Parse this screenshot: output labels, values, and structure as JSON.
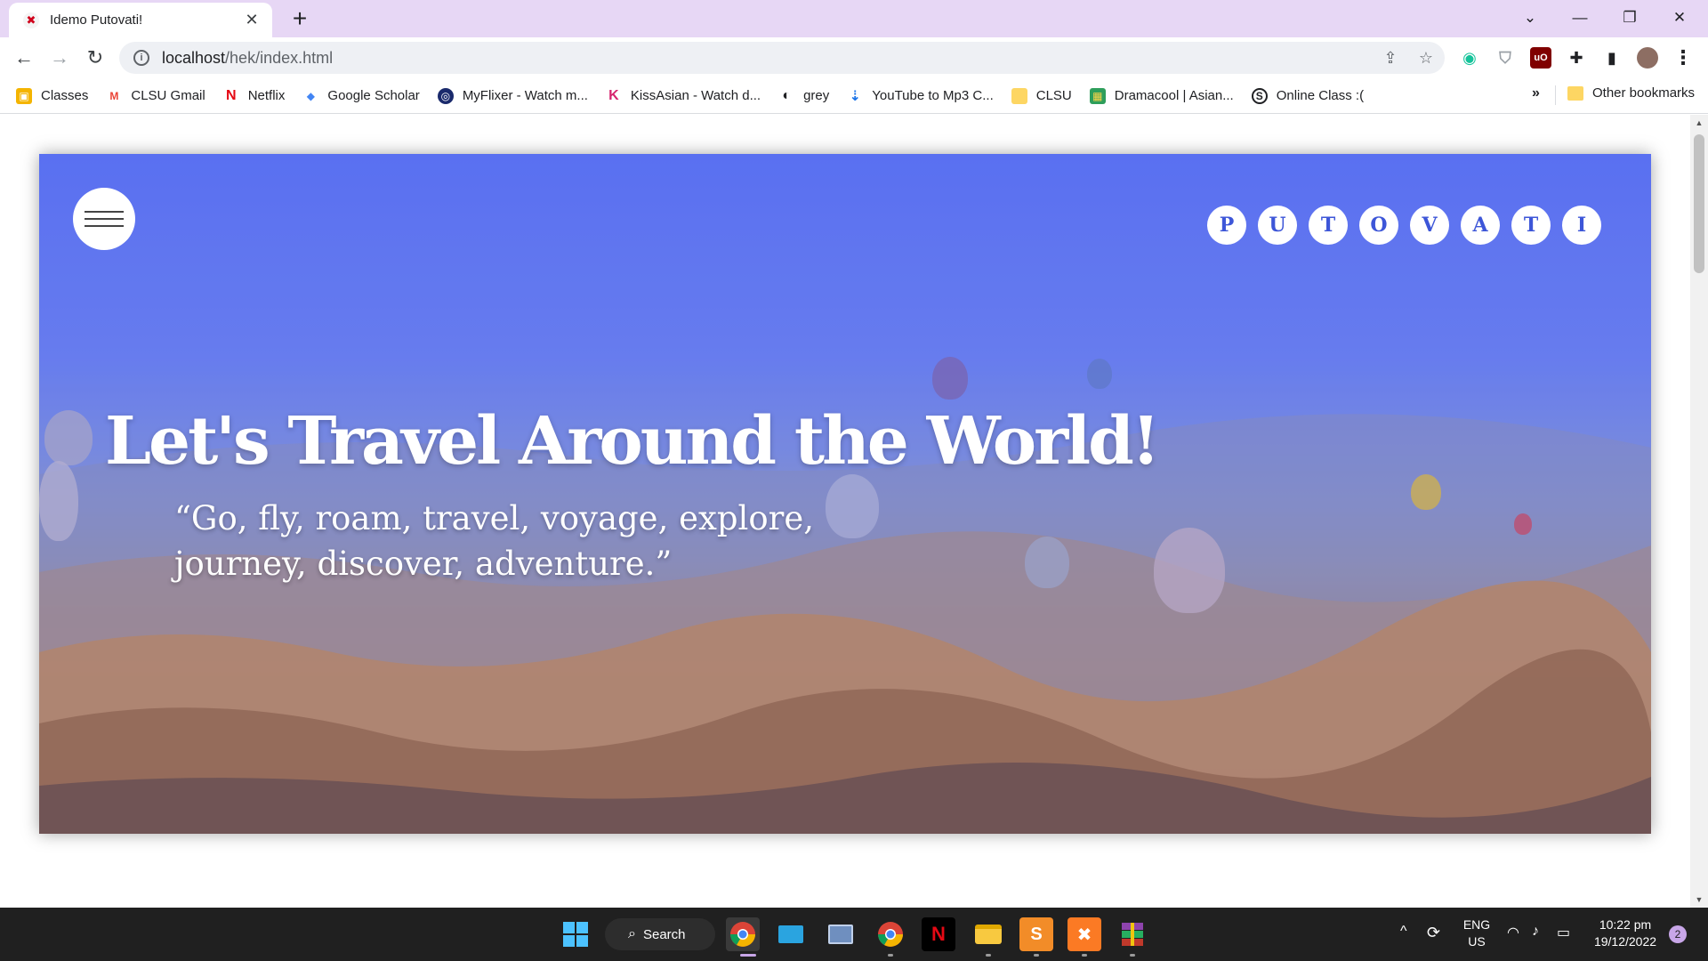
{
  "browser": {
    "tab_title": "Idemo Putovati!",
    "tab_close": "✕",
    "new_tab": "+",
    "window_controls": {
      "dropdown": "⌄",
      "minimize": "—",
      "restore": "❐",
      "close": "✕"
    },
    "nav": {
      "back": "←",
      "forward": "→",
      "reload": "↻"
    },
    "url_host": "localhost",
    "url_path": "/hek/index.html",
    "omnibox_icons": {
      "info": "i",
      "share": "⇪",
      "star": "☆"
    },
    "menu_icon": "⋮"
  },
  "bookmarks": [
    {
      "label": "Classes",
      "icon": "classroom-icon",
      "color": "#f4b400",
      "glyph": "▣"
    },
    {
      "label": "CLSU Gmail",
      "icon": "gmail-icon",
      "color": "#ea4335",
      "glyph": "M"
    },
    {
      "label": "Netflix",
      "icon": "netflix-icon",
      "color": "#e50914",
      "glyph": "N"
    },
    {
      "label": "Google Scholar",
      "icon": "scholar-icon",
      "color": "#4285f4",
      "glyph": "◆"
    },
    {
      "label": "MyFlixer - Watch m...",
      "icon": "myflixer-icon",
      "color": "#1a2a6c",
      "glyph": "◎"
    },
    {
      "label": "KissAsian - Watch d...",
      "icon": "kissasian-icon",
      "color": "#d6246e",
      "glyph": "K"
    },
    {
      "label": "grey",
      "icon": "globe-icon",
      "color": "#202124",
      "glyph": "◐"
    },
    {
      "label": "YouTube to Mp3 C...",
      "icon": "download-cloud-icon",
      "color": "#1a73e8",
      "glyph": "⇣"
    },
    {
      "label": "CLSU",
      "icon": "folder-icon",
      "color": "#fdd663",
      "glyph": "▬"
    },
    {
      "label": "Dramacool | Asian...",
      "icon": "dramacool-icon",
      "color": "#2e9e5b",
      "glyph": "▦"
    },
    {
      "label": "Online Class :(",
      "icon": "skype-icon",
      "color": "#202124",
      "glyph": "S"
    }
  ],
  "bookmarks_more": "»",
  "other_bookmarks": "Other bookmarks",
  "page": {
    "menu_aria": "menu",
    "logo_letters": [
      "P",
      "U",
      "T",
      "O",
      "V",
      "A",
      "T",
      "I"
    ],
    "hero_title": "Let's Travel Around the World!",
    "hero_quote": "“Go, fly, roam, travel, voyage, explore, journey, discover, adventure.”",
    "accent_color": "#3d56d8"
  },
  "taskbar": {
    "search_label": "Search",
    "search_icon": "⌕",
    "language": "ENG",
    "region": "US",
    "time": "10:22 pm",
    "date": "19/12/2022",
    "notification_count": "2",
    "tray_chevron": "^"
  }
}
